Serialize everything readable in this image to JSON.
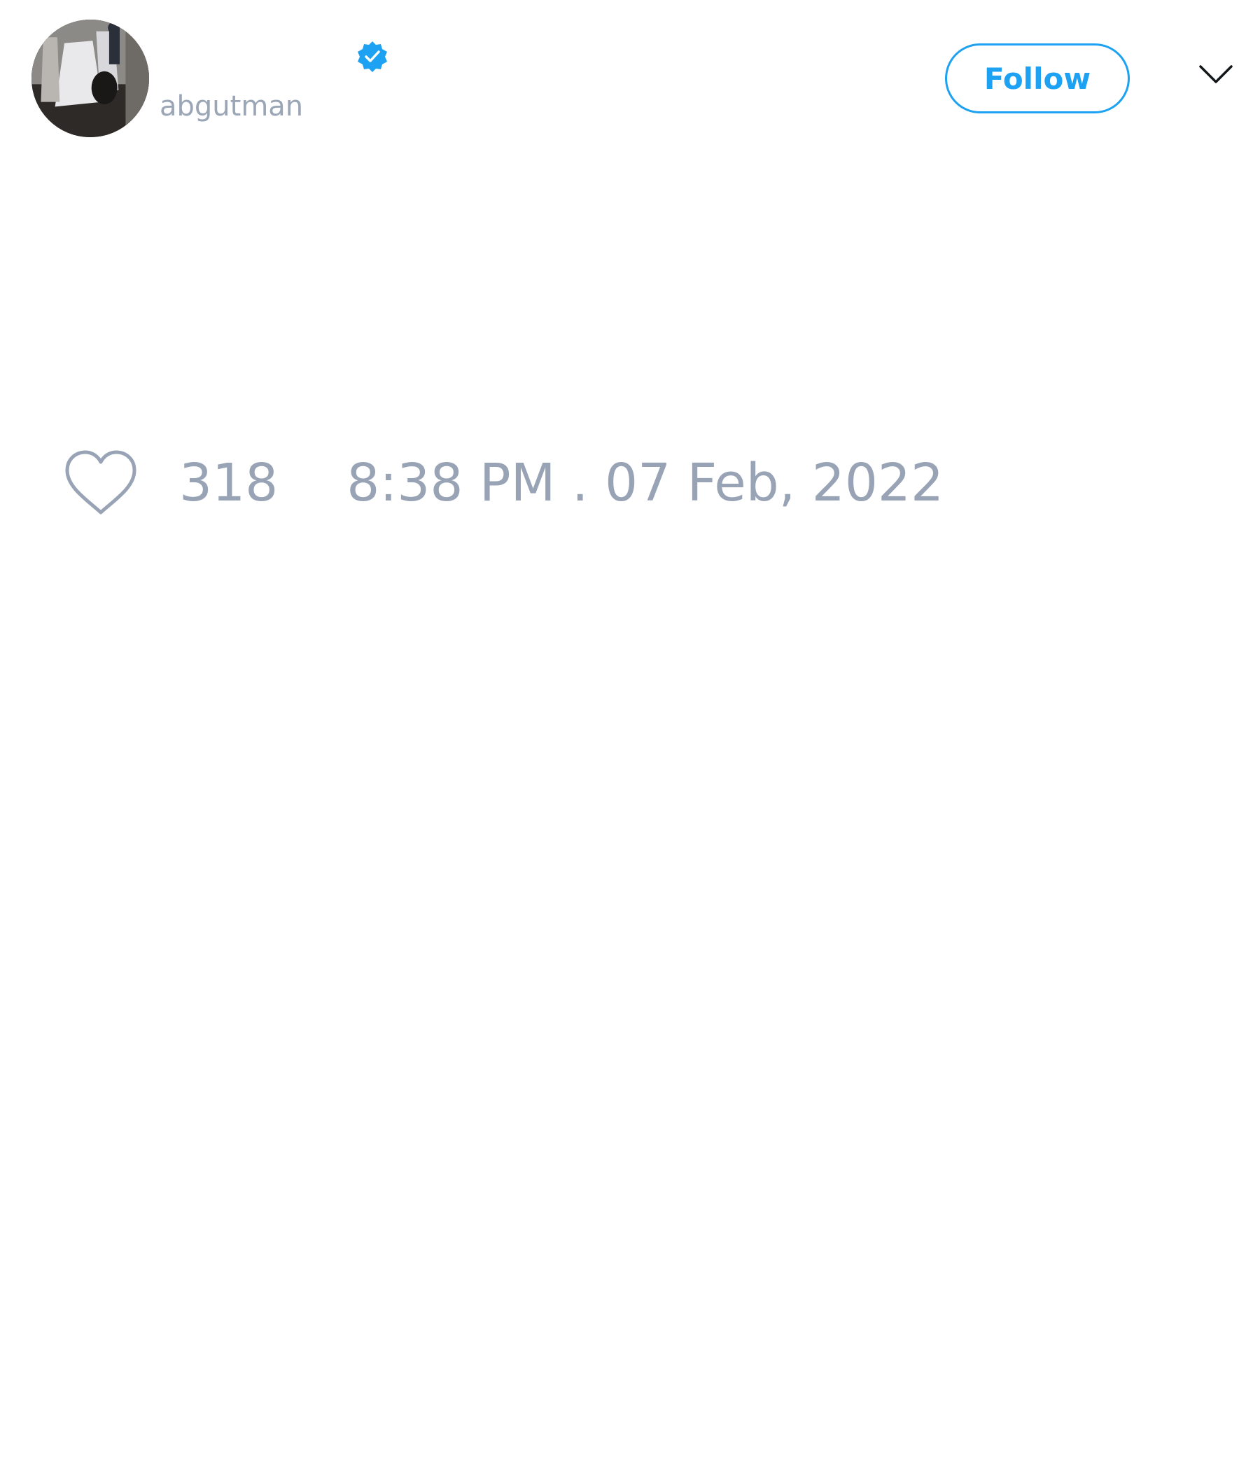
{
  "tweet": {
    "author": {
      "handle": "abgutman",
      "verified": true,
      "avatar_icon": "avatar-photo-icon"
    },
    "actions": {
      "follow_label": "Follow",
      "menu_icon": "chevron-down-icon"
    },
    "footer": {
      "like_icon": "heart-outline-icon",
      "like_count": "318",
      "timestamp": "8:38 PM . 07 Feb, 2022"
    }
  },
  "colors": {
    "accent": "#1da1f2",
    "muted_text": "#98a4b5",
    "background": "#ffffff",
    "icon_dark": "#14171a"
  }
}
